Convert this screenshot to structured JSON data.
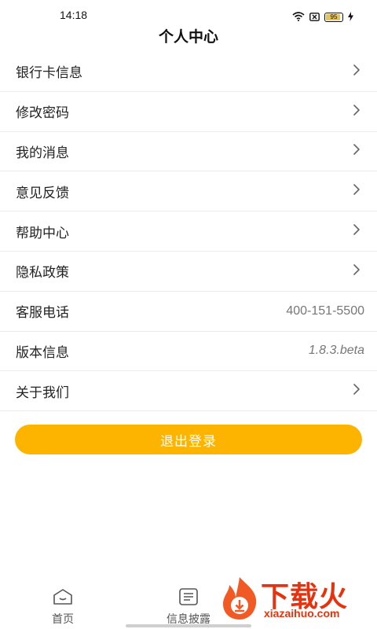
{
  "status": {
    "time": "14:18",
    "battery": "95",
    "battery_level": 0.95
  },
  "header": {
    "title": "个人中心"
  },
  "menu": {
    "items": [
      {
        "label": "银行卡信息",
        "value": "",
        "chevron": true
      },
      {
        "label": "修改密码",
        "value": "",
        "chevron": true
      },
      {
        "label": "我的消息",
        "value": "",
        "chevron": true
      },
      {
        "label": "意见反馈",
        "value": "",
        "chevron": true
      },
      {
        "label": "帮助中心",
        "value": "",
        "chevron": true
      },
      {
        "label": "隐私政策",
        "value": "",
        "chevron": true
      },
      {
        "label": "客服电话",
        "value": "400-151-5500",
        "chevron": false
      },
      {
        "label": "版本信息",
        "value": "1.8.3.beta",
        "chevron": false
      },
      {
        "label": "关于我们",
        "value": "",
        "chevron": true
      }
    ]
  },
  "actions": {
    "logout_label": "退出登录"
  },
  "tabbar": {
    "tabs": [
      {
        "label": "首页",
        "icon": "home-icon"
      },
      {
        "label": "信息披露",
        "icon": "document-icon"
      }
    ]
  },
  "watermark": {
    "text_cn": "下载火",
    "url": "xiazaihuo.com"
  },
  "colors": {
    "accent": "#fdb401",
    "watermark": "#e8320e",
    "divider": "#ececec"
  }
}
